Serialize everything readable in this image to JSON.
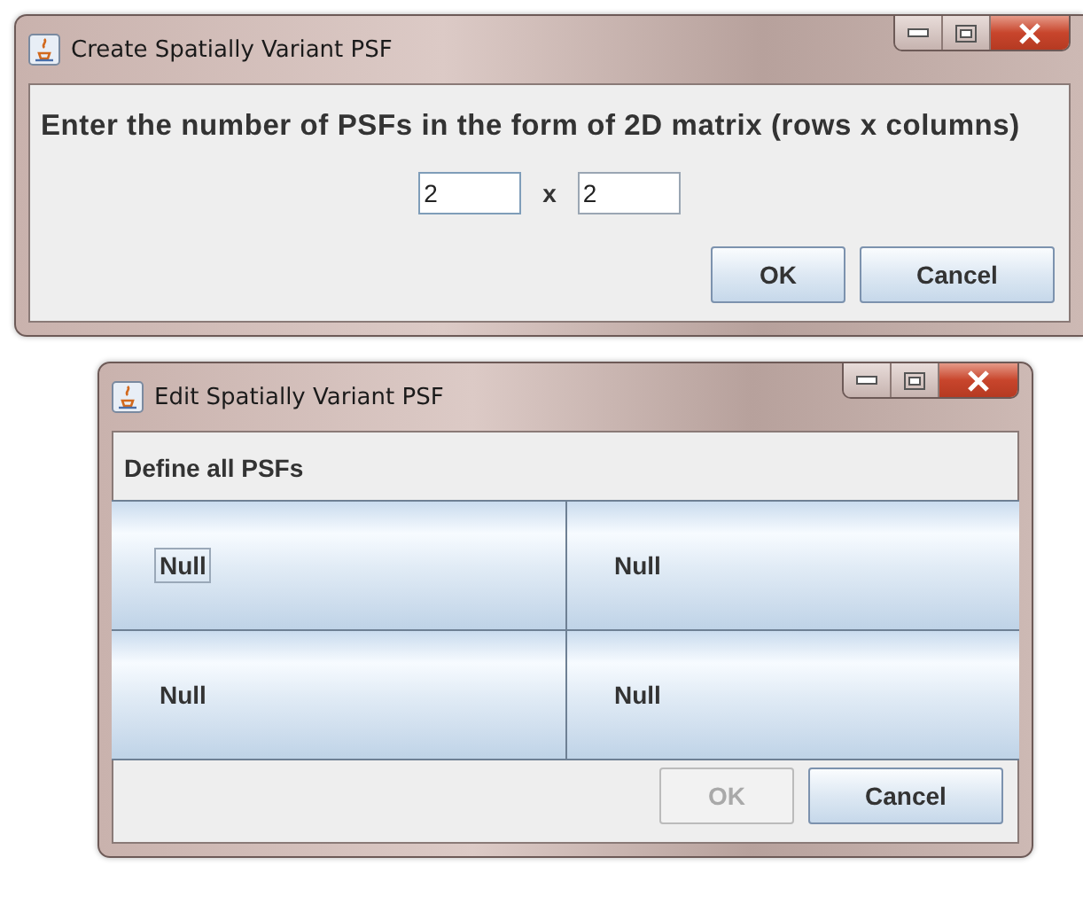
{
  "dialogs": [
    {
      "title": "Create Spatially Variant PSF",
      "kind": "size",
      "prompt": "Enter the number of PSFs in the form of 2D matrix (rows x columns)",
      "rows_field": {
        "value": "2",
        "focused": true
      },
      "separator": "x",
      "columns_field": {
        "value": "2",
        "focused": false
      },
      "buttons": [
        {
          "label": "OK",
          "disabled": false
        },
        {
          "label": "Cancel",
          "disabled": false
        }
      ]
    },
    {
      "title": "Edit Spatially Variant PSF",
      "kind": "grid",
      "prompt": "Define all PSFs",
      "cells": [
        {
          "label": "Null",
          "focused": true
        },
        {
          "label": "Null",
          "focused": false
        },
        {
          "label": "Null",
          "focused": false
        },
        {
          "label": "Null",
          "focused": false
        }
      ],
      "buttons": [
        {
          "label": "OK",
          "disabled": true
        },
        {
          "label": "Cancel",
          "disabled": false
        }
      ]
    }
  ]
}
